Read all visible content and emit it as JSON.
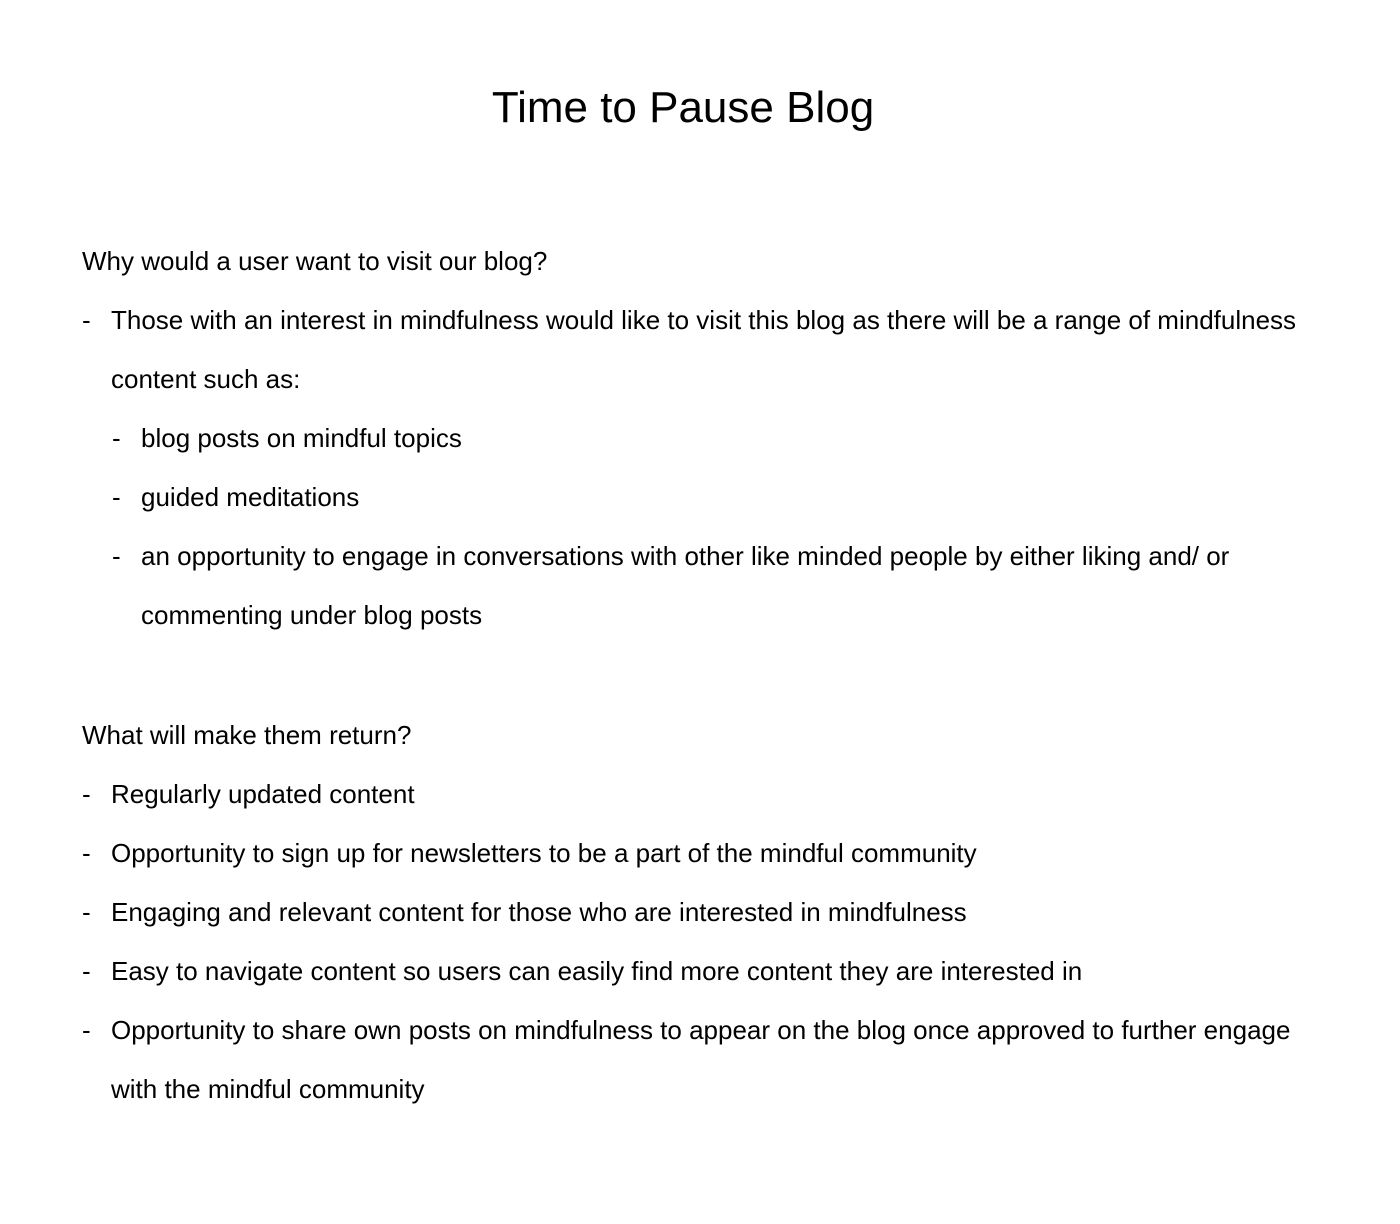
{
  "title": "Time to Pause Blog",
  "sections": [
    {
      "heading": "Why would a user want to visit our blog?",
      "items": [
        {
          "text": "Those with an interest in mindfulness would like to visit this blog as there will be a range of mindfulness content such as:"
        },
        {
          "text": "blog posts on mindful topics"
        },
        {
          "text": "guided meditations"
        },
        {
          "text": "an opportunity to engage in conversations with other like minded people by either liking and/ or commenting under blog posts"
        }
      ]
    },
    {
      "heading": "What will make them return?",
      "items": [
        {
          "text": "Regularly updated content"
        },
        {
          "text": "Opportunity to sign up for newsletters to be a part of the mindful community"
        },
        {
          "text": "Engaging and relevant content for those who are interested in mindfulness"
        },
        {
          "text": "Easy to navigate content so users can easily find more content they are interested in"
        },
        {
          "text": "Opportunity to share own posts on mindfulness to appear on the blog once approved to further engage with the mindful community"
        }
      ]
    }
  ],
  "bullet_glyph": "-"
}
